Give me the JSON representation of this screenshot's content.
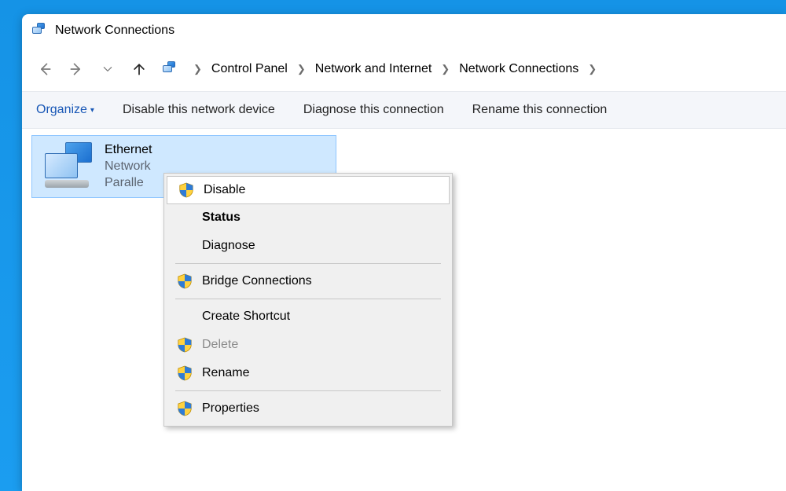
{
  "window_title": "Network Connections",
  "breadcrumbs": {
    "items": [
      "Control Panel",
      "Network and Internet",
      "Network Connections"
    ]
  },
  "toolbar": {
    "organize": "Organize",
    "disable": "Disable this network device",
    "diagnose": "Diagnose this connection",
    "rename": "Rename this connection"
  },
  "connection": {
    "name": "Ethernet",
    "status": "Network",
    "adapter_visible": "Paralle"
  },
  "context_menu": {
    "disable": "Disable",
    "status": "Status",
    "diagnose": "Diagnose",
    "bridge": "Bridge Connections",
    "shortcut": "Create Shortcut",
    "delete": "Delete",
    "rename": "Rename",
    "properties": "Properties"
  }
}
